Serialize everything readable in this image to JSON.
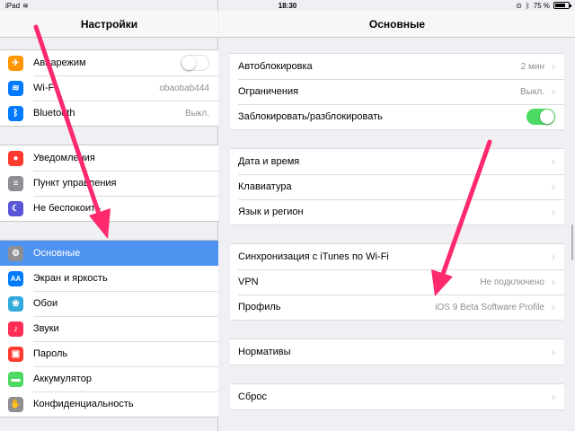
{
  "status_bar": {
    "device": "iPad",
    "time": "18:30",
    "battery": "75 %"
  },
  "sidebar": {
    "title": "Настройки",
    "group1": [
      {
        "label": "Авиарежим",
        "icon": "airplane-icon",
        "color": "#ff9500",
        "glyph": "✈",
        "toggle": "off"
      },
      {
        "label": "Wi-Fi",
        "icon": "wifi-icon",
        "color": "#007aff",
        "glyph": "≋",
        "value": "obaobab444"
      },
      {
        "label": "Bluetooth",
        "icon": "bluetooth-icon",
        "color": "#007aff",
        "glyph": "ᛒ",
        "value": "Выкл."
      }
    ],
    "group2": [
      {
        "label": "Уведомления",
        "icon": "notifications-icon",
        "color": "#ff3b30",
        "glyph": "●"
      },
      {
        "label": "Пункт управления",
        "icon": "control-center-icon",
        "color": "#8e8e93",
        "glyph": "≡"
      },
      {
        "label": "Не беспокоить",
        "icon": "moon-icon",
        "color": "#5856d6",
        "glyph": "☾"
      }
    ],
    "group3": [
      {
        "label": "Основные",
        "icon": "gear-icon",
        "color": "#8e8e93",
        "glyph": "⚙",
        "selected": true
      },
      {
        "label": "Экран и яркость",
        "icon": "display-icon",
        "color": "#007aff",
        "glyph": "AA"
      },
      {
        "label": "Обои",
        "icon": "wallpaper-icon",
        "color": "#34aadc",
        "glyph": "❀"
      },
      {
        "label": "Звуки",
        "icon": "sound-icon",
        "color": "#ff2d55",
        "glyph": "♪"
      },
      {
        "label": "Пароль",
        "icon": "lock-icon",
        "color": "#ff3b30",
        "glyph": "▣"
      },
      {
        "label": "Аккумулятор",
        "icon": "battery-icon",
        "color": "#4cd964",
        "glyph": "▬"
      },
      {
        "label": "Конфиденциальность",
        "icon": "hand-icon",
        "color": "#8e8e93",
        "glyph": "✋"
      }
    ]
  },
  "main": {
    "title": "Основные",
    "groups": [
      [
        {
          "label": "Автоблокировка",
          "value": "2 мин",
          "chevron": true
        },
        {
          "label": "Ограничения",
          "value": "Выкл.",
          "chevron": true
        },
        {
          "label": "Заблокировать/разблокировать",
          "toggle": "on"
        }
      ],
      [
        {
          "label": "Дата и время",
          "chevron": true
        },
        {
          "label": "Клавиатура",
          "chevron": true
        },
        {
          "label": "Язык и регион",
          "chevron": true
        }
      ],
      [
        {
          "label": "Синхронизация с iTunes по Wi-Fi",
          "chevron": true
        },
        {
          "label": "VPN",
          "value": "Не подключено",
          "chevron": true
        },
        {
          "label": "Профиль",
          "value": "iOS 9 Beta Software Profile",
          "chevron": true
        }
      ],
      [
        {
          "label": "Нормативы",
          "chevron": true
        }
      ],
      [
        {
          "label": "Сброс",
          "chevron": true
        }
      ]
    ]
  },
  "colors": {
    "accent": "#4f93f0",
    "toggle_on": "#4cd964",
    "arrow": "#ff2a6d"
  }
}
